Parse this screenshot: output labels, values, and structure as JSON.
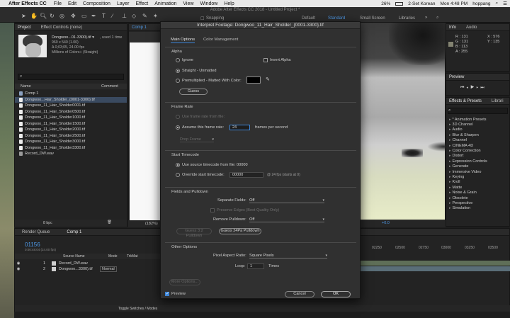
{
  "menubar": {
    "app_name": "After Effects CC",
    "items": [
      "File",
      "Edit",
      "Composition",
      "Layer",
      "Effect",
      "Animation",
      "View",
      "Window",
      "Help"
    ],
    "battery": "26%",
    "input_source": "2-Set Korean",
    "clock": "Mon 4:48 PM",
    "user": "hoppang"
  },
  "toolbar": {
    "app_title": "Adobe After Effects CC 2018 - Untitled Project *",
    "snapping_label": "Snapping",
    "workspaces": [
      "Default",
      "Standard",
      "Small Screen",
      "Libraries"
    ],
    "active_workspace": "Standard"
  },
  "project_panel": {
    "tabs": [
      "Project",
      "Effect Controls (none)"
    ],
    "thumb_name": "Dongwoo...01-3300).tif ▾",
    "thumb_used": ", used 1 time",
    "thumb_info": [
      "960 x 540 (1.00)",
      "Δ 0;03;05, 24.00 fps",
      "Millions of Colors+ (Straight)"
    ],
    "search_placeholder": "",
    "col_name": "Name",
    "col_comment": "Comment",
    "items": [
      "Comp 1",
      "Dongwoo...Hair_Sholder_{0001-3300}.tif",
      "Dongwoo_11_Hair_Sholder0001.tif",
      "Dongwoo_11_Hair_Sholder0500.tif",
      "Dongwoo_11_Hair_Sholder1000.tif",
      "Dongwoo_11_Hair_Sholder1500.tif",
      "Dongwoo_11_Hair_Sholder2000.tif",
      "Dongwoo_11_Hair_Sholder2500.tif",
      "Dongwoo_11_Hair_Sholder3000.tif",
      "Dongwoo_11_Hair_Sholder3300.tif",
      "Record_DW.wav"
    ],
    "bpc": "8 bpc"
  },
  "viewer": {
    "tab": "Comp 1",
    "zoom": "(182%)",
    "exposure": "+0.0"
  },
  "info_panel": {
    "tabs": [
      "Info",
      "Audio"
    ],
    "r": "R : 131",
    "g": "G : 131",
    "b": "B : 113",
    "a": "A : 255",
    "x": "X : 576",
    "y": "Y : 135"
  },
  "preview_panel": {
    "title": "Preview"
  },
  "effects_panel": {
    "tabs": [
      "Effects & Presets",
      "Librari"
    ],
    "items": [
      "* Animation Presets",
      "3D Channel",
      "Audio",
      "Blur & Sharpen",
      "Channel",
      "CINEMA 4D",
      "Color Correction",
      "Distort",
      "Expression Controls",
      "Generate",
      "Immersive Video",
      "Keying",
      "Kroll",
      "Matte",
      "Noise & Grain",
      "Obsolete",
      "Perspective",
      "Simulation"
    ]
  },
  "timeline": {
    "tabs": [
      "Render Queue",
      "Comp 1"
    ],
    "timecode": "01156",
    "timecode_sub": "0:00:48:04 (24.00 fps)",
    "col_source": "Source Name",
    "col_mode": "Mode",
    "col_trkmat": "TrkMat",
    "layers": [
      {
        "num": "1",
        "name": "Record_DW.wav",
        "mode": ""
      },
      {
        "num": "2",
        "name": "Dongwoo...3300).tif",
        "mode": "Normal"
      }
    ],
    "ruler": [
      "00250",
      "02250",
      "02500",
      "02750",
      "03000",
      "03250",
      "03500"
    ],
    "toggle_label": "Toggle Switches / Modes"
  },
  "dialog": {
    "title": "Interpret Footage: Dongwoo_11_Hair_Sholder_{0001-3300}.tif",
    "tabs": [
      "Main Options",
      "Color Management"
    ],
    "alpha": {
      "title": "Alpha",
      "ignore": "Ignore",
      "invert": "Invert Alpha",
      "straight": "Straight - Unmatted",
      "premult": "Premultiplied - Matted With Color:",
      "guess": "Guess"
    },
    "frame_rate": {
      "title": "Frame Rate",
      "use_file": "Use frame rate from file:",
      "assume": "Assume this frame rate:",
      "rate_value": "24",
      "frames_per_second": "frames per second",
      "drop_frame": "Drop Frame"
    },
    "start_timecode": {
      "title": "Start Timecode",
      "use_source": "Use source timecode from file:",
      "source_value": "00000",
      "override": "Override start timecode:",
      "override_value": "00000",
      "fps_note": "@ 24 fps (starts at 0)"
    },
    "fields": {
      "title": "Fields and Pulldown",
      "separate_label": "Separate Fields:",
      "separate_value": "Off",
      "preserve_edges": "Preserve Edges (Best Quality Only)",
      "remove_pulldown_label": "Remove Pulldown:",
      "remove_pulldown_value": "Off",
      "guess32": "Guess 3:2 Pulldown",
      "guess24": "Guess 24Pa Pulldown"
    },
    "other": {
      "title": "Other Options",
      "par_label": "Pixel Aspect Ratio:",
      "par_value": "Square Pixels",
      "loop_label": "Loop:",
      "loop_value": "1",
      "times": "Times",
      "more": "More Options..."
    },
    "preview_label": "Preview",
    "cancel": "Cancel",
    "ok": "OK",
    "colors": {
      "matte_swatch": "#000000",
      "accent": "#3d86d8"
    }
  }
}
